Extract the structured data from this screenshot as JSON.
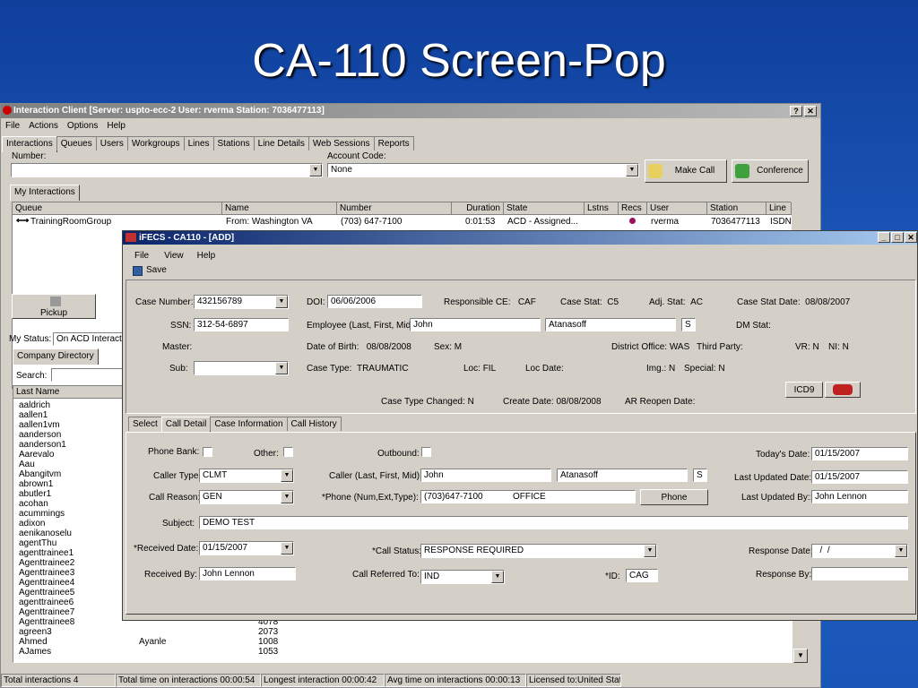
{
  "slide": {
    "title": "CA-110 Screen-Pop"
  },
  "ic": {
    "title": "Interaction Client  [Server: uspto-ecc-2   User: rverma   Station: 7036477113]",
    "menu": [
      "File",
      "Actions",
      "Options",
      "Help"
    ],
    "tabs": [
      "Interactions",
      "Queues",
      "Users",
      "Workgroups",
      "Lines",
      "Stations",
      "Line Details",
      "Web Sessions",
      "Reports"
    ],
    "number_label": "Number:",
    "account_label": "Account Code:",
    "account_value": "None",
    "make_call": "Make Call",
    "conference": "Conference",
    "my_interactions_tab": "My Interactions",
    "columns": [
      "Queue",
      "Name",
      "Number",
      "Duration",
      "State",
      "Lstns",
      "Recs",
      "User",
      "Station",
      "Line"
    ],
    "row": {
      "queue": "TrainingRoomGroup",
      "name": "From:  Washington VA",
      "number": "(703) 647-7100",
      "duration": "0:01:53",
      "state": "ACD - Assigned...",
      "user": "rverma",
      "station": "7036477113",
      "line": "ISDN"
    },
    "pickup": "Pickup",
    "my_status_label": "My Status:",
    "my_status_value": "On ACD Interaction",
    "company_directory": "Company Directory",
    "search_label": "Search:",
    "last_name_header": "Last Name",
    "directory": [
      "aaldrich",
      "aallen1",
      "aallen1vm",
      "aanderson",
      "aanderson1",
      "Aarevalo",
      "Aau",
      "Abangitvm",
      "abrown1",
      "abutler1",
      "acohan",
      "acummings",
      "adixon",
      "aenikanoselu",
      "agentThu",
      "agenttrainee1",
      "Agenttrainee2",
      "Agenttrainee3",
      "Agenttrainee4",
      "Agenttrainee5",
      "agenttrainee6",
      "Agenttrainee7",
      "Agenttrainee8",
      "agreen3",
      "Ahmed",
      "AJames"
    ],
    "dir_rows_extra": [
      {
        "name": "Agenttrainee8",
        "first": "",
        "ext": "4078"
      },
      {
        "name": "agreen3",
        "first": "",
        "ext": "2073"
      },
      {
        "name": "Ahmed",
        "first": "Ayanle",
        "ext": "1008"
      },
      {
        "name": "AJames",
        "first": "",
        "ext": "1053"
      }
    ],
    "status": [
      "Total interactions 4",
      "Total time on interactions 00:00:54",
      "Longest interaction 00:00:42",
      "Avg time on interactions 00:00:13",
      "Licensed to:United States"
    ]
  },
  "fecs": {
    "title": "iFECS - CA110 - [ADD]",
    "menu": [
      "File",
      "View",
      "Help"
    ],
    "save": "Save",
    "case_number_label": "Case Number:",
    "case_number": "432156789",
    "doi_label": "DOI:",
    "doi": "06/06/2006",
    "resp_ce_label": "Responsible CE:",
    "resp_ce": "CAF",
    "case_stat_label": "Case Stat:",
    "case_stat": "C5",
    "adj_stat_label": "Adj. Stat:",
    "adj_stat": "AC",
    "case_stat_date_label": "Case Stat Date:",
    "case_stat_date": "08/08/2007",
    "ssn_label": "SSN:",
    "ssn": "312-54-6897",
    "employee_label": "Employee (Last, First, Mid):",
    "emp_first": "John",
    "emp_last": "Atanasoff",
    "emp_mid": "S",
    "dm_stat_label": "DM Stat:",
    "master_label": "Master:",
    "dob_label": "Date of Birth:",
    "dob": "08/08/2008",
    "sex_label": "Sex:",
    "sex": "M",
    "district_label": "District Office:",
    "district": "WAS",
    "third_party_label": "Third Party:",
    "vr_label": "VR:",
    "vr": "N",
    "ni_label": "NI:",
    "ni": "N",
    "sub_label": "Sub:",
    "case_type_label": "Case Type:",
    "case_type": "TRAUMATIC",
    "loc_label": "Loc:",
    "loc": "FIL",
    "loc_date_label": "Loc Date:",
    "img_label": "Img.:",
    "img": "N",
    "special_label": "Special:",
    "special": "N",
    "case_type_changed_label": "Case Type Changed:",
    "case_type_changed": "N",
    "create_date_label": "Create Date:",
    "create_date": "08/08/2008",
    "ar_reopen_label": "AR Reopen Date:",
    "icd9": "ICD9",
    "tabs": [
      "Select",
      "Call Detail",
      "Case Information",
      "Call History"
    ],
    "phone_bank_label": "Phone Bank:",
    "other_label": "Other:",
    "outbound_label": "Outbound:",
    "todays_date_label": "Today's Date:",
    "todays_date": "01/15/2007",
    "caller_type_label": "Caller Type:",
    "caller_type": "CLMT",
    "caller_label": "Caller (Last, First, Mid):",
    "caller_first": "John",
    "caller_last": "Atanasoff",
    "caller_mid": "S",
    "last_updated_date_label": "Last Updated Date:",
    "last_updated_date": "01/15/2007",
    "call_reason_label": "Call Reason:",
    "call_reason": "GEN",
    "phone_label": "*Phone (Num,Ext,Type):",
    "phone": "(703)647-7100            OFFICE",
    "phone_btn": "Phone",
    "last_updated_by_label": "Last Updated By::",
    "last_updated_by": "John Lennon",
    "subject_label": "Subject:",
    "subject": "DEMO TEST",
    "received_date_label": "*Received Date:",
    "received_date": "01/15/2007",
    "call_status_label": "*Call Status:",
    "call_status": "RESPONSE REQUIRED",
    "response_date_label": "Response Date:",
    "response_date": "  /  /",
    "received_by_label": "Received By:",
    "received_by": "John Lennon",
    "call_referred_label": "Call Referred To:",
    "call_referred": "IND",
    "id_label": "*ID:",
    "id": "CAG",
    "response_by_label": "Response By:"
  }
}
